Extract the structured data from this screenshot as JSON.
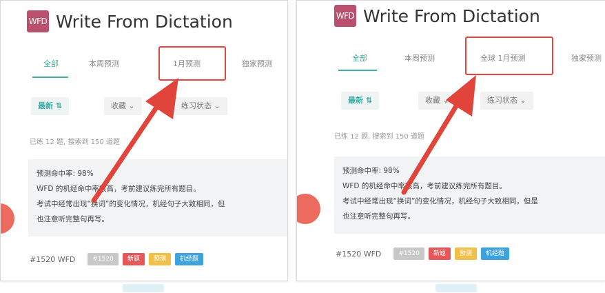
{
  "colors": {
    "accent": "#3aaea5",
    "logo_bg": "#b8506e",
    "annotation_red": "#e0443a",
    "tag_gray": "#c8c8c8",
    "tag_red": "#e6575a",
    "tag_yellow": "#f1c04a",
    "tag_blue": "#3ea3dc"
  },
  "left": {
    "logo": "WFD",
    "title": "Write From Dictation",
    "tabs": [
      "全部",
      "本周预测",
      "1月预测",
      "独家预测"
    ],
    "sort_label": "最新 ⇅",
    "filters": [
      "收藏 ⌄",
      "练习状态 ⌄"
    ],
    "meta": "已练 12 题, 搜索到 150 道题",
    "info_lines": [
      "预测命中率: 98%",
      "WFD 的机经命中率很高，考前建议练完所有题目。",
      "考试中经常出现“换词”的变化情况，机经句子大致相同，但",
      "也注意听完整句再写。"
    ],
    "qid": "#1520 WFD",
    "tags": [
      "#1520",
      "新题",
      "预测",
      "机经题"
    ]
  },
  "right": {
    "logo": "WFD",
    "title": "Write From Dictation",
    "tabs": [
      "全部",
      "本周预测",
      "全球 1月预测",
      "独家预测"
    ],
    "sort_label": "最新 ⇅",
    "filters": [
      "收藏 ⌄",
      "练习状态 ⌄"
    ],
    "meta": "已练 12 题, 搜索到 150 道题",
    "info_lines": [
      "预测命中率: 98%",
      "WFD 的机经命中率很高，考前建议练完所有题目。",
      "考试中经常出现“换词”的变化情况，机经句子大致相同，但是",
      "也注意听完整句再写。"
    ],
    "qid": "#1520 WFD",
    "tags": [
      "#1520",
      "新题",
      "预测",
      "机经题"
    ]
  }
}
